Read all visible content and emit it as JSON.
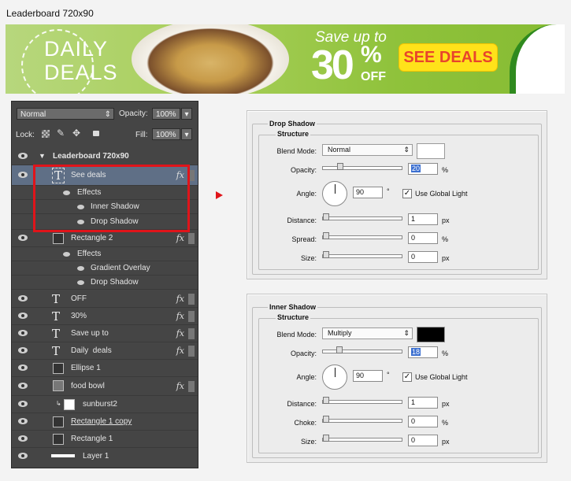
{
  "title": "Leaderboard 720x90",
  "banner": {
    "daily": "DAILY",
    "deals": "DEALS",
    "save": "Save up to",
    "big": "30",
    "pct": "%",
    "off": "OFF",
    "cta": "SEE DEALS"
  },
  "layers_panel": {
    "blend_mode": "Normal",
    "opacity_label": "Opacity:",
    "opacity_value": "100%",
    "lock_label": "Lock:",
    "fill_label": "Fill:",
    "fill_value": "100%",
    "group_name": "Leaderboard 720x90",
    "rows": [
      {
        "name": "See deals",
        "fx": "fx"
      },
      {
        "name": "Effects"
      },
      {
        "name": "Inner Shadow"
      },
      {
        "name": "Drop Shadow"
      },
      {
        "name": "Rectangle 2",
        "fx": "fx"
      },
      {
        "name": "Effects"
      },
      {
        "name": "Gradient Overlay"
      },
      {
        "name": "Drop Shadow"
      },
      {
        "name": "OFF",
        "fx": "fx"
      },
      {
        "name": "30%",
        "fx": "fx"
      },
      {
        "name": "Save up to",
        "fx": "fx"
      },
      {
        "name": "Daily  deals",
        "fx": "fx"
      },
      {
        "name": "Ellipse 1"
      },
      {
        "name": "food bowl",
        "fx": "fx"
      },
      {
        "name": "sunburst2"
      },
      {
        "name": "Rectangle 1 copy"
      },
      {
        "name": "Rectangle 1"
      },
      {
        "name": "Layer 1"
      }
    ]
  },
  "drop_shadow": {
    "title": "Drop Shadow",
    "structure": "Structure",
    "blend_label": "Blend Mode:",
    "blend_value": "Normal",
    "color": "#ffffff",
    "opacity_label": "Opacity:",
    "opacity_value": "20",
    "opacity_unit": "%",
    "angle_label": "Angle:",
    "angle_value": "90",
    "angle_unit": "°",
    "global_light": "Use Global Light",
    "distance_label": "Distance:",
    "distance_value": "1",
    "distance_unit": "px",
    "spread_label": "Spread:",
    "spread_value": "0",
    "spread_unit": "%",
    "size_label": "Size:",
    "size_value": "0",
    "size_unit": "px"
  },
  "inner_shadow": {
    "title": "Inner Shadow",
    "structure": "Structure",
    "blend_label": "Blend Mode:",
    "blend_value": "Multiply",
    "color": "#000000",
    "opacity_label": "Opacity:",
    "opacity_value": "18",
    "opacity_unit": "%",
    "angle_label": "Angle:",
    "angle_value": "90",
    "angle_unit": "°",
    "global_light": "Use Global Light",
    "distance_label": "Distance:",
    "distance_value": "1",
    "distance_unit": "px",
    "choke_label": "Choke:",
    "choke_value": "0",
    "choke_unit": "%",
    "size_label": "Size:",
    "size_value": "0",
    "size_unit": "px"
  },
  "colors": {
    "highlight": "#e0141a",
    "arrow": "#e0141a",
    "banner_green": "#8fc23b",
    "cta_yellow": "#ffe21a"
  }
}
